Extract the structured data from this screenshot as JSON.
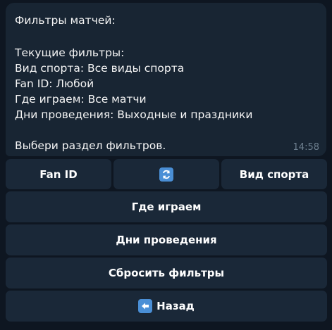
{
  "message": {
    "lines": [
      "Фильтры матчей:",
      "",
      "Текущие фильтры:",
      "Вид спорта: Все виды спорта",
      "Fan ID: Любой",
      "Где играем: Все матчи",
      "Дни проведения: Выходные и праздники",
      "",
      "Выбери раздел фильтров."
    ],
    "time": "14:58"
  },
  "keyboard": {
    "fan_id": "Fan ID",
    "refresh_icon": "refresh-icon",
    "sport": "Вид спорта",
    "where": "Где играем",
    "days": "Дни проведения",
    "reset": "Сбросить фильтры",
    "back": "Назад",
    "back_icon": "arrow-left-icon"
  },
  "colors": {
    "background": "#0e1621",
    "bubble": "#182533",
    "button": "#1a2838",
    "emoji_blue": "#4a8fd6",
    "time": "#6d7f8f"
  }
}
